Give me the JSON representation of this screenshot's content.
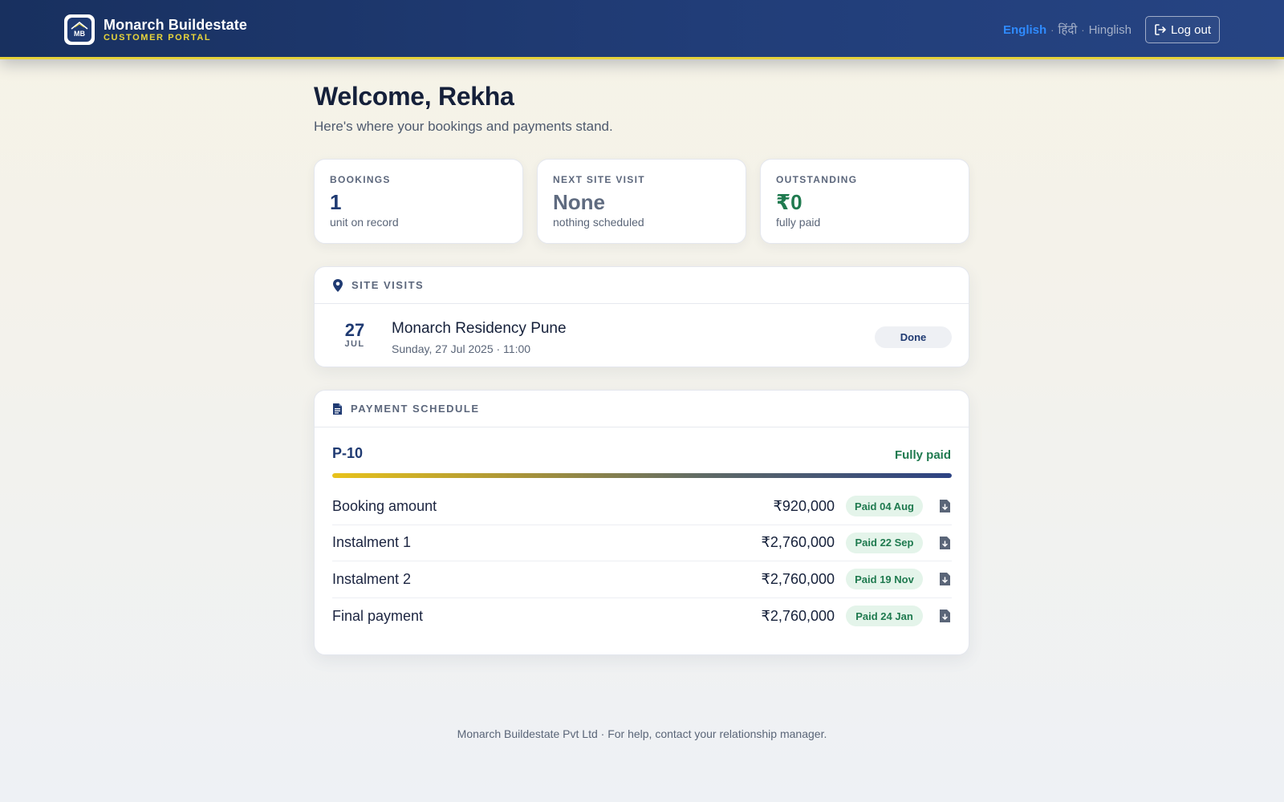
{
  "brand": {
    "name": "Monarch Buildestate",
    "subtitle": "CUSTOMER PORTAL",
    "logo_text": "MB",
    "icon": "building-logo-icon"
  },
  "header": {
    "languages": [
      {
        "label": "English",
        "active": true
      },
      {
        "label": "हिंदी",
        "active": false
      },
      {
        "label": "Hinglish",
        "active": false
      }
    ],
    "separator": "·",
    "logout_label": "Log out",
    "logout_icon": "sign-out-icon"
  },
  "welcome": {
    "title": "Welcome, Rekha",
    "subtitle": "Here's where your bookings and payments stand."
  },
  "stats": [
    {
      "label": "BOOKINGS",
      "value": "1",
      "note": "unit on record",
      "color": "#1f3a72"
    },
    {
      "label": "NEXT SITE VISIT",
      "value": "None",
      "note": "nothing scheduled",
      "color": "#5f6b80"
    },
    {
      "label": "OUTSTANDING",
      "value": "₹0",
      "note": "fully paid",
      "color": "#1f7a4f"
    }
  ],
  "site_visits": {
    "title": "SITE VISITS",
    "icon": "map-pin-icon",
    "items": [
      {
        "day": "27",
        "month": "JUL",
        "project": "Monarch Residency Pune",
        "when": "Sunday, 27 Jul 2025 · 11:00",
        "status": "Done"
      }
    ]
  },
  "payment_schedule": {
    "title": "PAYMENT SCHEDULE",
    "icon": "document-icon",
    "unit": "P-10",
    "status": "Fully paid",
    "progress": 1.0,
    "rows": [
      {
        "label": "Booking amount",
        "amount": "₹920,000",
        "badge": "Paid 04 Aug"
      },
      {
        "label": "Instalment 1",
        "amount": "₹2,760,000",
        "badge": "Paid 22 Sep"
      },
      {
        "label": "Instalment 2",
        "amount": "₹2,760,000",
        "badge": "Paid 19 Nov"
      },
      {
        "label": "Final payment",
        "amount": "₹2,760,000",
        "badge": "Paid 24 Jan"
      }
    ],
    "download_icon": "file-download-icon"
  },
  "footer": {
    "text": "Monarch Buildestate Pvt Ltd · For help, contact your relationship manager."
  },
  "colors": {
    "header_bg": "#1f3a72",
    "accent_yellow": "#e8d53b",
    "link_blue": "#2f8bff",
    "paid_green": "#1f7a4f"
  }
}
